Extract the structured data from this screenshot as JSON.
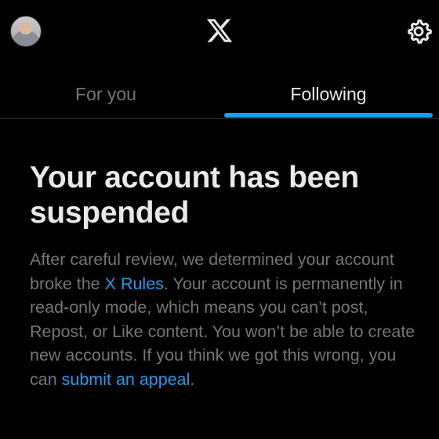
{
  "header": {
    "avatar_icon": "user-avatar",
    "logo_icon": "x-logo-icon",
    "settings_icon": "gear-icon"
  },
  "tabs": [
    {
      "label": "For you",
      "selected": false
    },
    {
      "label": "Following",
      "selected": true
    }
  ],
  "notice": {
    "title": "Your account has been suspended",
    "body_part1": "After careful review, we determined your account broke the ",
    "rules_link": "X Rules",
    "body_part2": ". Your account is permanently in read-only mode, which means you can’t post, Repost, or Like content. You won’t be able to create new accounts. If you think we got this wrong, you can ",
    "appeal_link": "submit an appeal",
    "body_part3": "."
  },
  "colors": {
    "background": "#000000",
    "accent": "#1d9bf0",
    "muted_text": "#71767b",
    "primary_text": "#e7e9ea"
  }
}
